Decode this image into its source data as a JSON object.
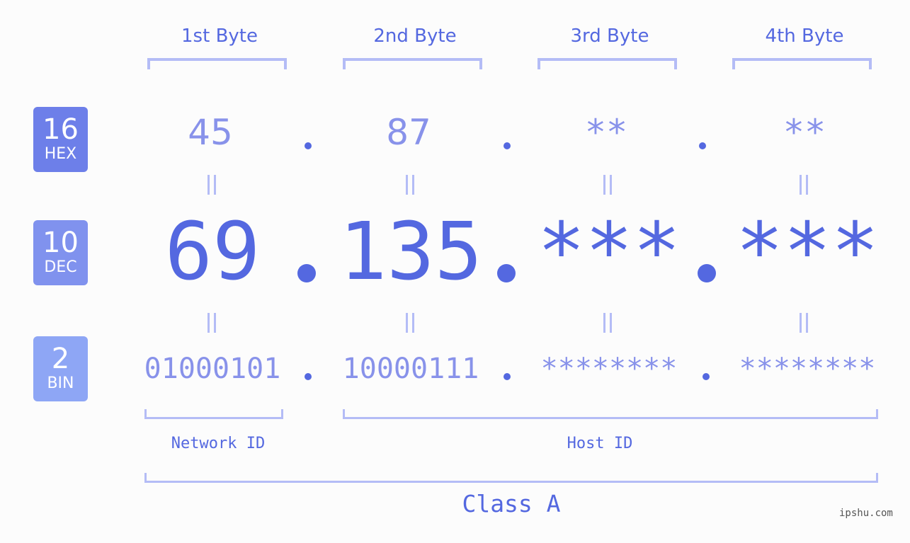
{
  "badges": [
    {
      "num": "16",
      "label": "HEX",
      "color": "#6d7fe9"
    },
    {
      "num": "10",
      "label": "DEC",
      "color": "#8092ee"
    },
    {
      "num": "2",
      "label": "BIN",
      "color": "#8ea6f5"
    }
  ],
  "bytes": [
    {
      "label": "1st Byte",
      "hex": "45",
      "dec": "69",
      "bin": "01000101"
    },
    {
      "label": "2nd Byte",
      "hex": "87",
      "dec": "135",
      "bin": "10000111"
    },
    {
      "label": "3rd Byte",
      "hex": "**",
      "dec": "***",
      "bin": "********"
    },
    {
      "label": "4th Byte",
      "hex": "**",
      "dec": "***",
      "bin": "********"
    }
  ],
  "separator": ".",
  "network_id_label": "Network ID",
  "host_id_label": "Host ID",
  "class_label": "Class A",
  "watermark": "ipshu.com",
  "colors": {
    "accent": "#5468e0",
    "light": "#8892ea",
    "bracket": "#b4bcf6"
  }
}
